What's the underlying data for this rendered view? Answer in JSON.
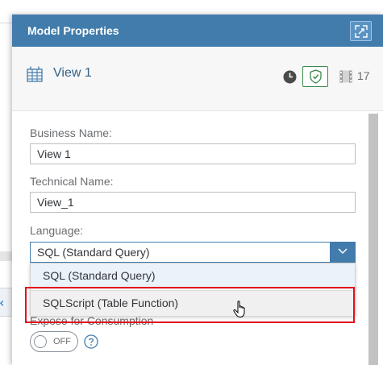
{
  "panel": {
    "title": "Model Properties",
    "view_name": "View 1",
    "dependency_count": "17"
  },
  "form": {
    "business_name_label": "Business Name:",
    "business_name_value": "View 1",
    "technical_name_label": "Technical Name:",
    "technical_name_value": "View_1",
    "language_label": "Language:",
    "language_value": "SQL (Standard Query)",
    "language_options": [
      "SQL (Standard Query)",
      "SQLScript (Table Function)"
    ],
    "expose_label": "Expose for Consumption",
    "toggle_text": "OFF"
  },
  "icons": {
    "expand": "expand-icon",
    "view": "view-table-icon",
    "clock": "clock-icon",
    "shield": "shield-check-icon",
    "film": "film-icon",
    "help": "help-icon",
    "chevron": "chevron-down-icon",
    "back_arrow": "chevron-left-icon"
  },
  "colors": {
    "header": "#427cac",
    "title_text": "#346187",
    "highlight_border": "#e3101b",
    "shield_green": "#3b8a4a"
  }
}
